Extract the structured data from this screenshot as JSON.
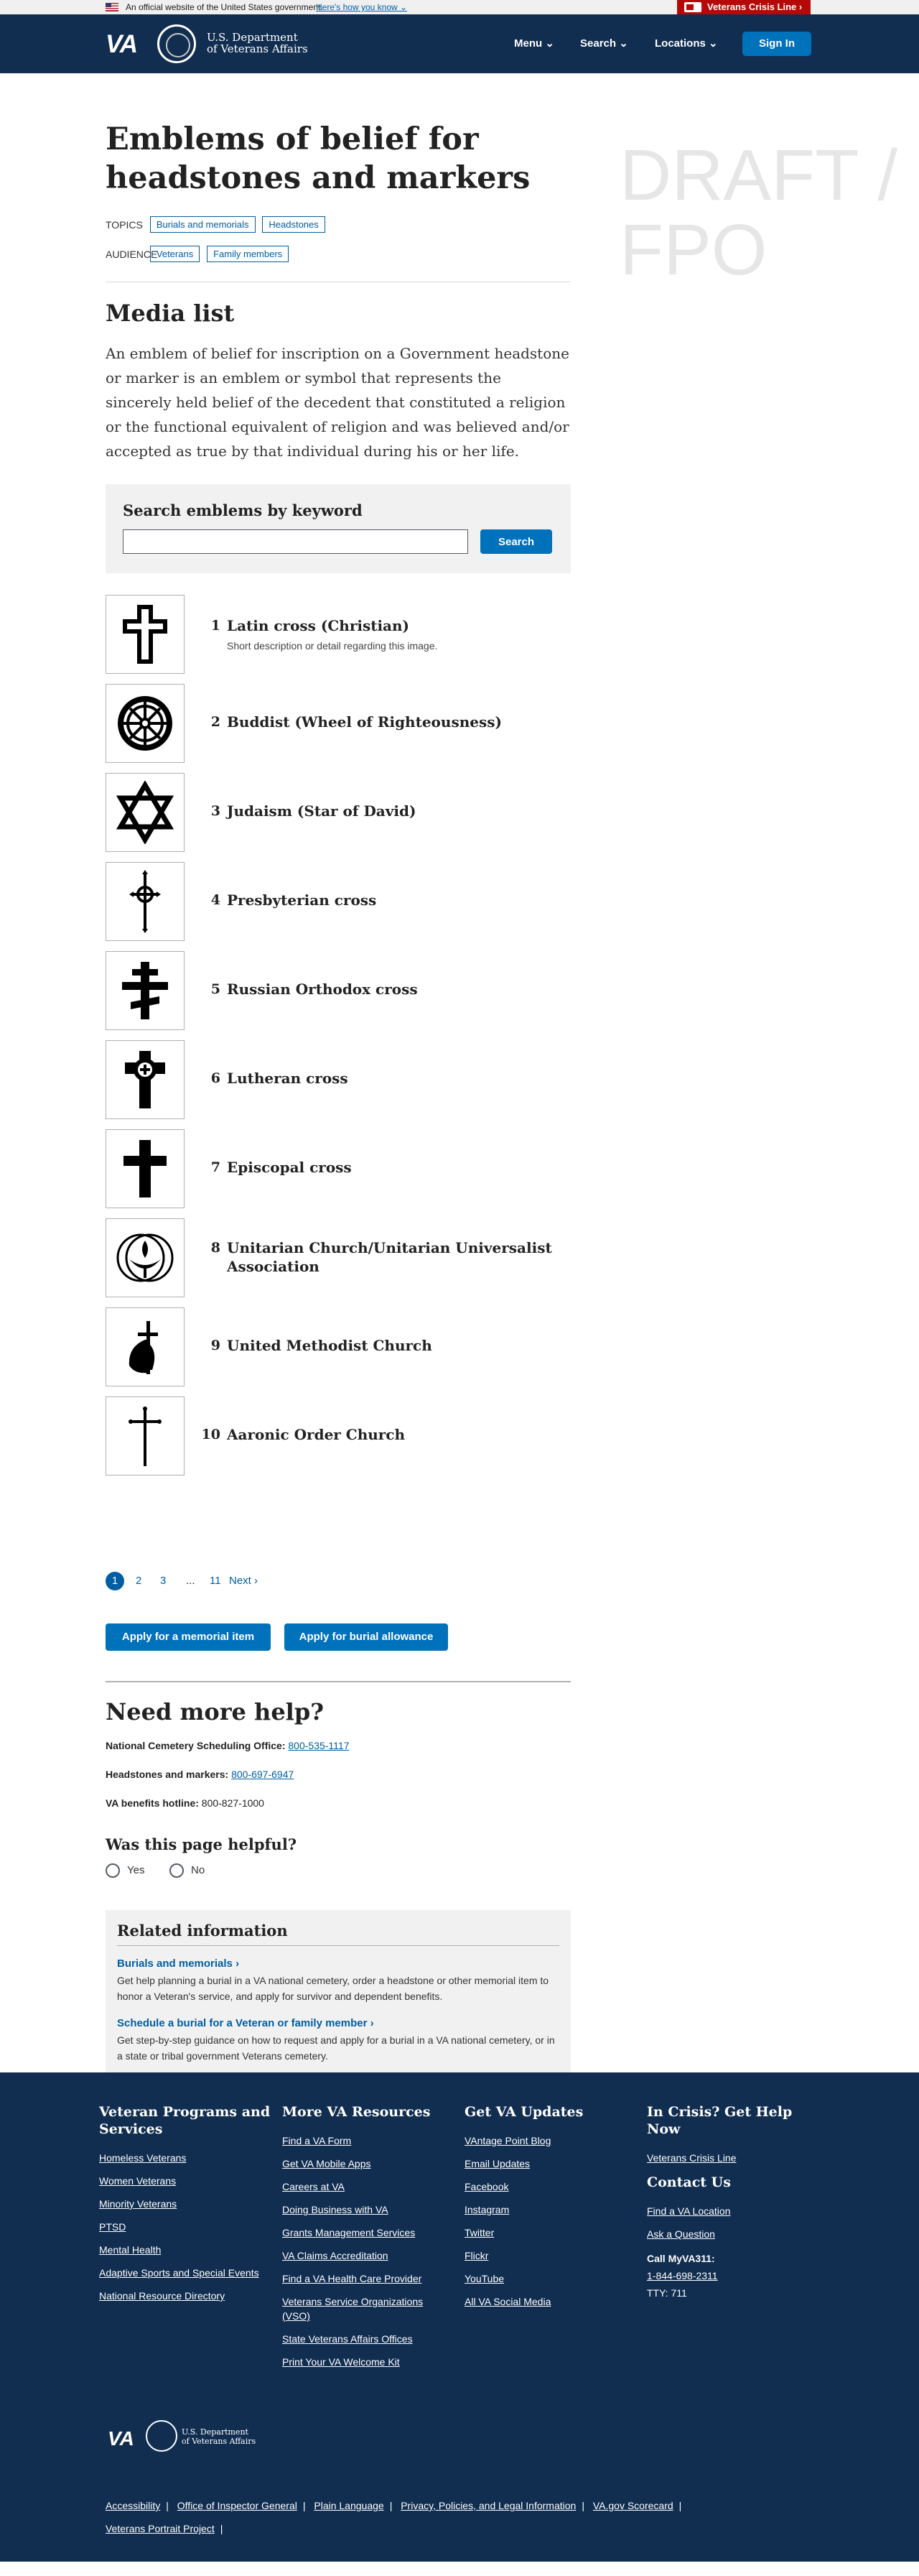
{
  "gov_banner": {
    "official_text": "An official website of the United States government.",
    "how_text": "Here's how you know",
    "crisis_line": "Veterans Crisis Line"
  },
  "header": {
    "logo": "VA",
    "dept_line1": "U.S. Department",
    "dept_line2": "of Veterans Affairs",
    "nav": [
      "Menu",
      "Search",
      "Locations"
    ],
    "sign_in": "Sign In"
  },
  "draft_text": "DRAFT / FPO",
  "page": {
    "title": "Emblems of belief for headstones and markers",
    "topics_label": "TOPICS",
    "topics": [
      "Burials and memorials",
      "Headstones"
    ],
    "audience_label": "AUDIENCE",
    "audience": [
      "Veterans",
      "Family members"
    ]
  },
  "media": {
    "heading": "Media list",
    "intro": "An emblem of belief for inscription on a Government headstone or marker is an emblem or symbol that represents the sincerely held belief of the decedent that constituted a religion or the functional equivalent of religion and was believed and/or accepted as true by that individual during his or her life.",
    "search_label": "Search emblems by keyword",
    "search_placeholder": "",
    "search_button": "Search",
    "items": [
      {
        "num": "1",
        "name": "Latin cross (Christian)",
        "desc": "Short description or detail regarding this image.",
        "icon": "latin-cross-icon"
      },
      {
        "num": "2",
        "name": "Buddist (Wheel of Righteousness)",
        "desc": "",
        "icon": "dharma-wheel-icon"
      },
      {
        "num": "3",
        "name": "Judaism (Star of David)",
        "desc": "",
        "icon": "star-of-david-icon"
      },
      {
        "num": "4",
        "name": "Presbyterian cross",
        "desc": "",
        "icon": "presbyterian-cross-icon"
      },
      {
        "num": "5",
        "name": "Russian Orthodox cross",
        "desc": "",
        "icon": "orthodox-cross-icon"
      },
      {
        "num": "6",
        "name": "Lutheran cross",
        "desc": "",
        "icon": "lutheran-cross-icon"
      },
      {
        "num": "7",
        "name": "Episcopal cross",
        "desc": "",
        "icon": "episcopal-cross-icon"
      },
      {
        "num": "8",
        "name": "Unitarian Church/Unitarian Universalist Association",
        "desc": "",
        "icon": "flaming-chalice-icon"
      },
      {
        "num": "9",
        "name": "United Methodist Church",
        "desc": "",
        "icon": "cross-and-flame-icon"
      },
      {
        "num": "10",
        "name": "Aaronic Order Church",
        "desc": "",
        "icon": "aaronic-cross-icon"
      }
    ]
  },
  "pagination": {
    "current": "1",
    "pages": [
      "2",
      "3"
    ],
    "ellipsis": "...",
    "last": "11",
    "next": "Next ›"
  },
  "actions": {
    "memorial": "Apply for a memorial item",
    "allowance": "Apply for burial allowance"
  },
  "help": {
    "heading": "Need more help?",
    "lines": [
      {
        "label": "National Cemetery Scheduling Office:",
        "value": "800-535-1117",
        "link": true
      },
      {
        "label": "Headstones and markers:",
        "value": "800-697-6947",
        "link": true
      },
      {
        "label": "VA benefits hotline:",
        "value": "800-827-1000",
        "link": false
      }
    ]
  },
  "feedback": {
    "question": "Was this page helpful?",
    "yes": "Yes",
    "no": "No"
  },
  "related": {
    "heading": "Related information",
    "items": [
      {
        "title": "Burials and memorials",
        "desc": "Get help planning a burial in a VA national cemetery, order a headstone or other memorial item to honor a Veteran's service, and apply for survivor and dependent benefits."
      },
      {
        "title": "Schedule a burial for a Veteran or family member",
        "desc": "Get step-by-step guidance on how to request and apply for a burial in a VA national cemetery, or in a state or tribal government Veterans cemetery."
      }
    ]
  },
  "footer": {
    "columns": [
      {
        "heading": "Veteran Programs and Services",
        "links": [
          "Homeless Veterans",
          "Women Veterans",
          "Minority Veterans",
          "PTSD",
          "Mental Health",
          "Adaptive Sports and Special Events",
          "National Resource Directory"
        ]
      },
      {
        "heading": "More VA Resources",
        "links": [
          "Find a VA Form",
          "Get VA Mobile Apps",
          "Careers at VA",
          "Doing Business with VA",
          "Grants Management Services",
          "VA Claims Accreditation",
          "Find a VA Health Care Provider",
          "Veterans Service Organizations (VSO)",
          "State Veterans Affairs Offices",
          "Print Your VA Welcome Kit"
        ]
      },
      {
        "heading": "Get VA Updates",
        "links": [
          "VAntage Point Blog",
          "Email Updates",
          "Facebook",
          "Instagram",
          "Twitter",
          "Flickr",
          "YouTube",
          "All VA Social Media"
        ]
      }
    ],
    "crisis": {
      "heading": "In Crisis? Get Help Now",
      "link": "Veterans Crisis Line",
      "contact_heading": "Contact Us",
      "contact_links": [
        "Find a VA Location",
        "Ask a Question"
      ],
      "call_label": "Call MyVA311:",
      "call_number": "1-844-698-2311",
      "tty": "TTY: 711"
    },
    "bottom_links_row1": [
      "Accessibility",
      "Office of Inspector General",
      "Plain Language",
      "Privacy, Policies, and Legal Information",
      "VA.gov Scorecard"
    ],
    "bottom_links_row2": [
      "Veterans Portrait Project"
    ]
  }
}
